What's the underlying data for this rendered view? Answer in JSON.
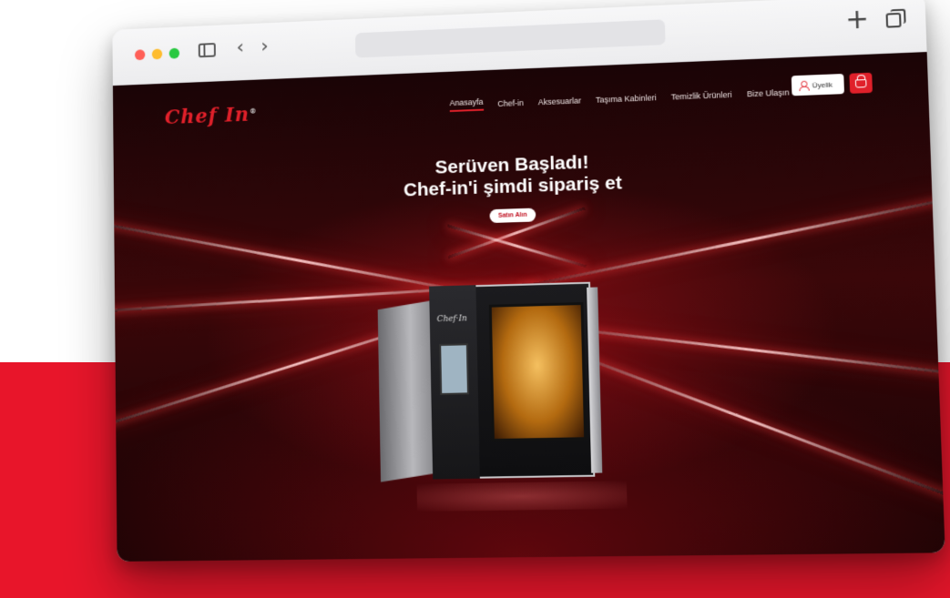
{
  "browser": {
    "url": ""
  },
  "site": {
    "logo": "Chef In",
    "nav": [
      {
        "label": "Anasayfa",
        "active": true
      },
      {
        "label": "Chef-in"
      },
      {
        "label": "Aksesuarlar"
      },
      {
        "label": "Taşıma Kabinleri"
      },
      {
        "label": "Temizlik Ürünleri"
      },
      {
        "label": "Bize Ulaşın"
      }
    ],
    "member_label": "Üyelik",
    "hero": {
      "line1": "Serüven Başladı!",
      "line2": "Chef-in'i şimdi sipariş et",
      "cta": "Satın Alın"
    }
  },
  "colors": {
    "brand_red": "#e0202a",
    "backdrop_red": "#e8152a"
  }
}
